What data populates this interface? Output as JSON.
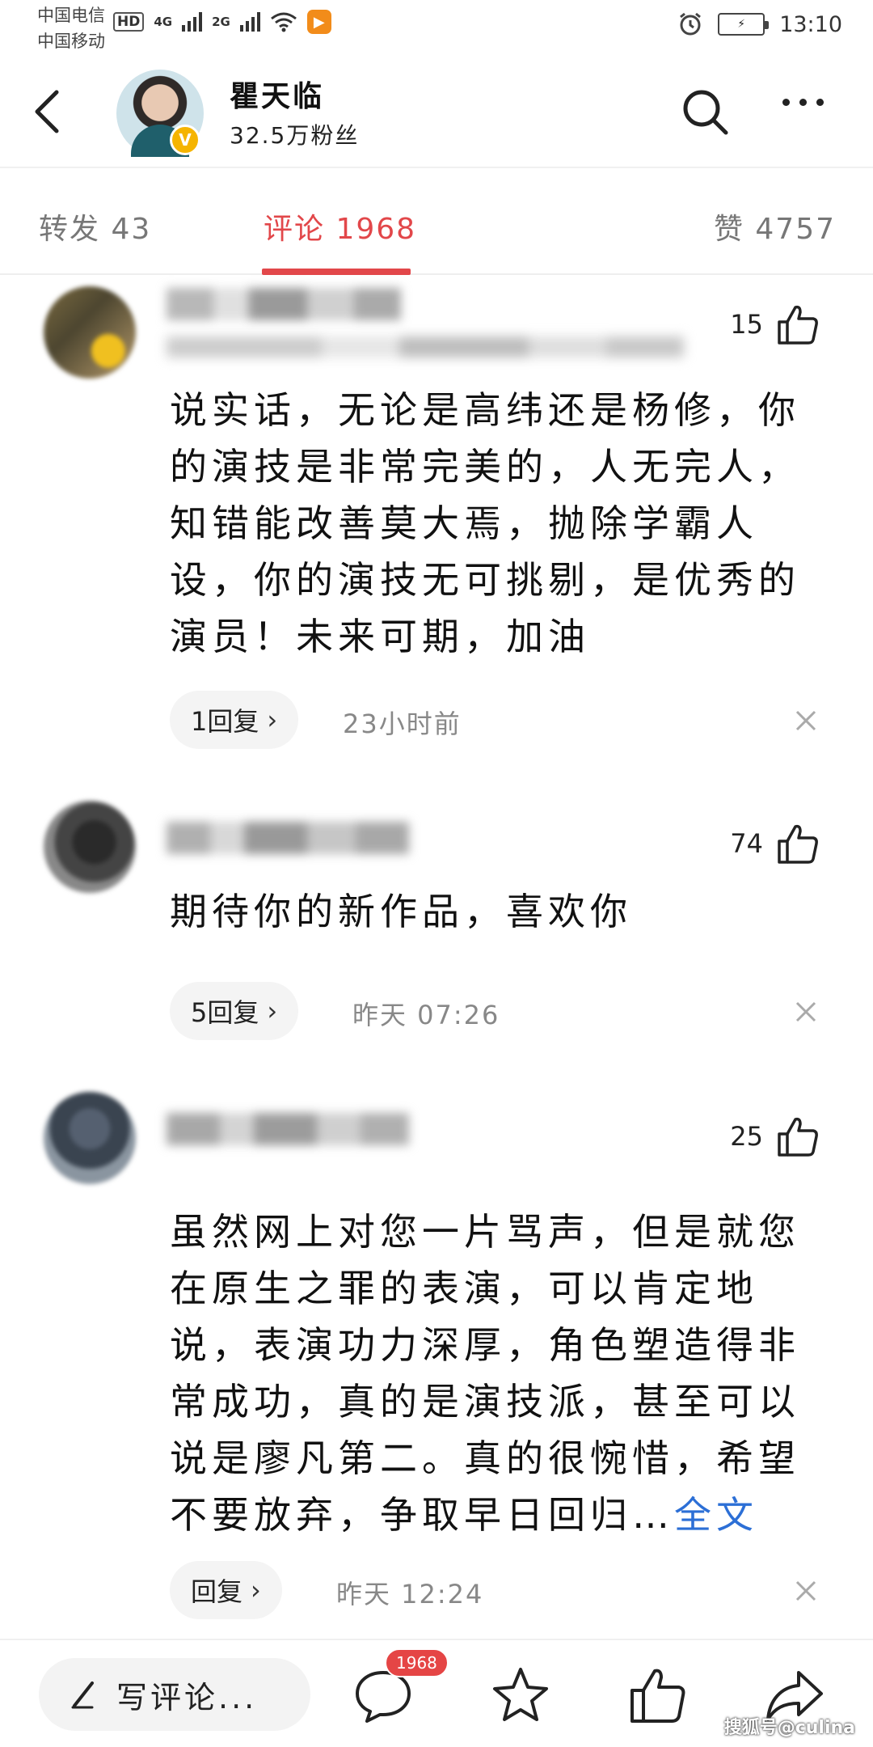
{
  "status_bar": {
    "carrier1": "中国电信",
    "carrier2": "中国移动",
    "hd": "HD",
    "net1": "4G",
    "net2": "2G",
    "time": "13:10"
  },
  "header": {
    "username": "瞿天临",
    "fans": "32.5万粉丝",
    "verified_badge": "V"
  },
  "tabs": {
    "repost": "转发 43",
    "comments": "评论 1968",
    "likes": "赞 4757"
  },
  "comments": [
    {
      "likes": "15",
      "text": "说实话，无论是高纬还是杨修，你的演技是非常完美的，人无完人，知错能改善莫大焉，抛除学霸人设，你的演技无可挑剔，是优秀的演员！未来可期，加油",
      "more": "",
      "replies": "1回复",
      "time": "23小时前"
    },
    {
      "likes": "74",
      "text": "期待你的新作品，喜欢你",
      "more": "",
      "replies": "5回复",
      "time": "昨天 07:26"
    },
    {
      "likes": "25",
      "text": "虽然网上对您一片骂声，但是就您在原生之罪的表演，可以肯定地说，表演功力深厚，角色塑造得非常成功，真的是演技派，甚至可以说是廖凡第二。真的很惋惜，希望不要放弃，争取早日回归…",
      "more": "全文",
      "replies": "回复",
      "time": "昨天 12:24"
    }
  ],
  "bottom_bar": {
    "write_placeholder": "写评论...",
    "comment_badge": "1968"
  },
  "watermark": "搜狐号@culina",
  "colors": {
    "accent_red": "#e2474a",
    "link_blue": "#2c6fd6"
  }
}
